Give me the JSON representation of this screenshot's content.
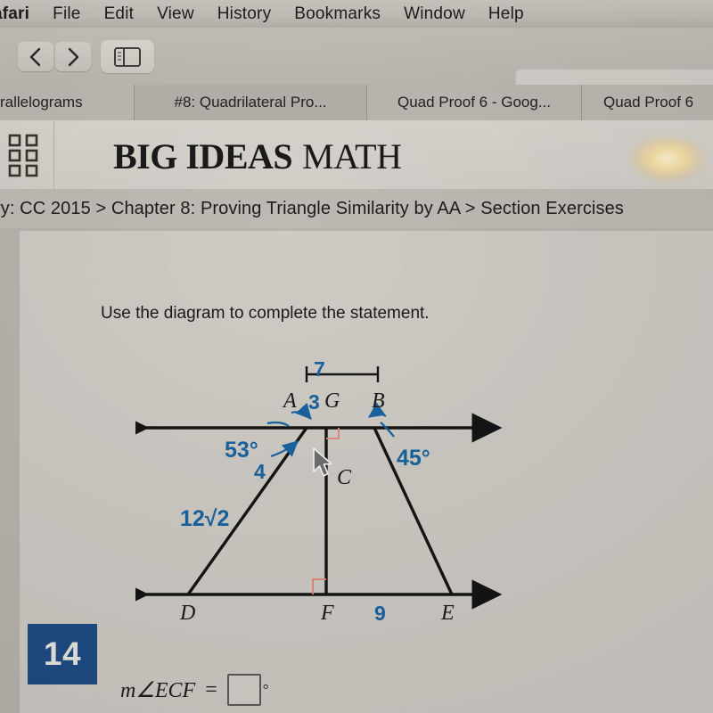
{
  "menubar": {
    "items": [
      {
        "label": "afari",
        "icon": "apple-menu-app"
      },
      {
        "label": "File"
      },
      {
        "label": "Edit"
      },
      {
        "label": "View"
      },
      {
        "label": "History"
      },
      {
        "label": "Bookmarks"
      },
      {
        "label": "Window"
      },
      {
        "label": "Help"
      }
    ]
  },
  "toolbar": {
    "back_icon": "chevron-left-icon",
    "forward_icon": "chevron-right-icon",
    "sidebar_icon": "sidebar-toggle-icon",
    "address_value": "",
    "address_placeholder": ""
  },
  "tabs": [
    {
      "label": "rallelograms",
      "active": false
    },
    {
      "label": "#8: Quadrilateral Pro...",
      "active": true
    },
    {
      "label": "Quad Proof 6 - Goog...",
      "active": false
    },
    {
      "label": "Quad Proof 6",
      "active": false
    }
  ],
  "site": {
    "grid_icon": "app-grid-icon",
    "logo_bold": "BIG IDEAS",
    "logo_light": "MATH",
    "breadcrumb": "ry: CC 2015 > Chapter 8: Proving Triangle Similarity by AA > Section Exercises"
  },
  "exercise": {
    "prompt": "Use the diagram to complete the statement.",
    "number": "14",
    "statement_lhs": "m∠ECF",
    "equals": "=",
    "answer_value": "",
    "degree_symbol": "°"
  },
  "diagram": {
    "type": "geometry-figure",
    "points": [
      "A",
      "G",
      "B",
      "C",
      "D",
      "F",
      "E"
    ],
    "labels": {
      "A": "A",
      "G": "G",
      "B": "B",
      "C": "C",
      "D": "D",
      "F": "F",
      "E": "E"
    },
    "measures": {
      "AG": "3",
      "AB": "7",
      "AC": "4",
      "DC": "12√2",
      "FE": "9",
      "angle_GAC": "53°",
      "angle_GBC": "45°"
    },
    "right_angles": [
      "at G on line AB",
      "at F on line DE"
    ],
    "cursor": "mouse-pointer"
  },
  "colors": {
    "annotation_blue": "#18639e",
    "badge_blue": "#1e4c85",
    "right_angle_pink": "#e0897c",
    "line_black": "#141414"
  }
}
